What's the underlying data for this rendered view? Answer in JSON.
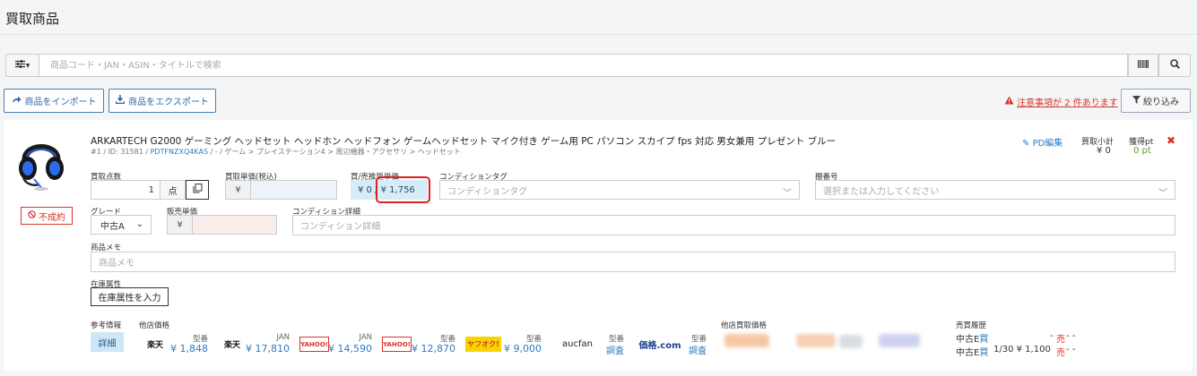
{
  "page": {
    "title": "買取商品"
  },
  "search": {
    "placeholder": "商品コード・JAN・ASIN・タイトルで検索"
  },
  "toolbar": {
    "import_label": "商品をインポート",
    "export_label": "商品をエクスポート",
    "warning_label": "注意事項が 2 件あります",
    "filter_label": "絞り込み"
  },
  "item": {
    "name": "ARKARTECH G2000 ゲーミング ヘッドセット ヘッドホン ヘッドフォン ゲームヘッドセット マイク付き ゲーム用 PC パソコン スカイプ fps 対応 男女兼用 プレゼント ブルー",
    "meta_prefix": "#1 / ID: 31581 / ",
    "meta_asin": "PDTFNZXQ4KAS",
    "meta_suffix": " / - / ゲーム > プレイステーション4 > 周辺機器・アクセサリ > ヘッドセット",
    "status": "不成約",
    "pd_edit": "PD編集",
    "subtotal_label": "買取小計",
    "subtotal_value": "¥ 0",
    "points_label": "獲得pt",
    "points_value": "0 pt"
  },
  "form": {
    "qty_label": "買取点数",
    "qty_value": "1",
    "qty_unit": "点",
    "buy_price_label": "買取単価(税込)",
    "yen": "¥",
    "tradein_label": "買/売推奨単価",
    "tradein_value": "¥ 0 / ¥ 1,756",
    "cond_tag_label": "コンディションタグ",
    "cond_tag_placeholder": "コンディションタグ",
    "shelf_label": "棚番号",
    "shelf_placeholder": "選択または入力してください",
    "grade_label": "グレード",
    "grade_value": "中古A",
    "sale_price_label": "販売単価",
    "cond_detail_label": "コンディション詳細",
    "cond_detail_placeholder": "コンディション詳細",
    "memo_label": "商品メモ",
    "memo_placeholder": "商品メモ",
    "attr_label": "在庫属性",
    "attr_button": "在庫属性を入力"
  },
  "ref": {
    "ref_label": "参考情報",
    "detail_button": "詳細",
    "other_label": "他店価格",
    "stores": [
      {
        "logo": "楽天",
        "kind": "型番",
        "price": "¥ 1,848"
      },
      {
        "logo": "楽天",
        "kind": "JAN",
        "price": "¥ 17,810"
      },
      {
        "logo": "YAHOO!",
        "kind": "JAN",
        "price": "¥ 14,590"
      },
      {
        "logo": "YAHOO!",
        "kind": "型番",
        "price": "¥ 12,870"
      },
      {
        "logo": "ヤフオク!",
        "kind": "型番",
        "price": "¥ 9,000"
      },
      {
        "logo": "aucfan",
        "kind": "型番",
        "price": "調査"
      },
      {
        "logo": "価格.com",
        "kind": "型番",
        "price": "調査"
      }
    ],
    "other_buy_label": "他店買取価格",
    "history_label": "売買履歴",
    "history": [
      {
        "grade": "中古E",
        "buy": "買",
        "buy_val": "",
        "sell_val": "-",
        "sell": "売",
        "tail": "- -"
      },
      {
        "grade": "中古E",
        "buy": "買",
        "buy_val": "1/30 ¥ 1,100",
        "sell_val": "",
        "sell": "売",
        "tail": "- -"
      }
    ]
  },
  "colors": {
    "accent": "#2f7bbf",
    "danger": "#d9342b",
    "points": "#5aa02c"
  }
}
